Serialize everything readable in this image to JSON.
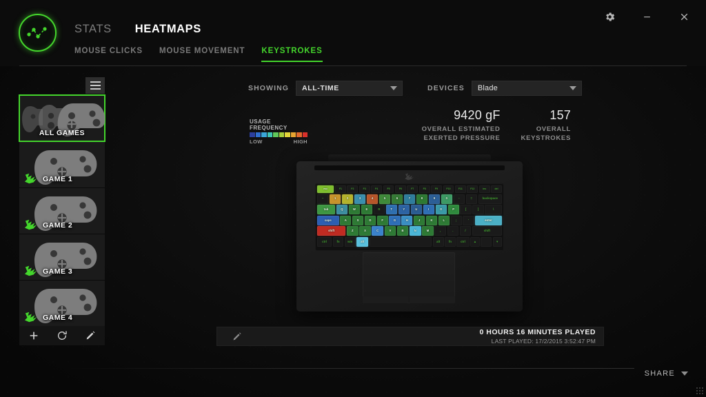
{
  "window": {
    "controls": [
      {
        "name": "settings-button",
        "icon": "gear-icon"
      },
      {
        "name": "minimize-button",
        "icon": "minimize-icon"
      },
      {
        "name": "close-button",
        "icon": "close-icon"
      }
    ]
  },
  "header": {
    "logo_icon": "razer-stats-logo-icon",
    "tabs": [
      {
        "label": "STATS",
        "active": false
      },
      {
        "label": "HEATMAPS",
        "active": true
      }
    ],
    "subtabs": [
      {
        "label": "MOUSE CLICKS",
        "active": false
      },
      {
        "label": "MOUSE MOVEMENT",
        "active": false
      },
      {
        "label": "KEYSTROKES",
        "active": true
      }
    ]
  },
  "sidebar": {
    "menu_icon": "hamburger-icon",
    "items": [
      {
        "label": "ALL GAMES",
        "selected": true,
        "has_icon": false
      },
      {
        "label": "GAME 1",
        "selected": false,
        "has_icon": true
      },
      {
        "label": "GAME 2",
        "selected": false,
        "has_icon": true
      },
      {
        "label": "GAME 3",
        "selected": false,
        "has_icon": true
      },
      {
        "label": "GAME 4",
        "selected": false,
        "has_icon": true
      }
    ],
    "actions": [
      {
        "name": "add-game-button",
        "icon": "plus-icon"
      },
      {
        "name": "refresh-games-button",
        "icon": "refresh-icon"
      },
      {
        "name": "edit-game-button",
        "icon": "pencil-icon"
      }
    ]
  },
  "toolbar": {
    "showing_label": "SHOWING",
    "showing_value": "ALL-TIME",
    "devices_label": "DEVICES",
    "devices_value": "Blade"
  },
  "legend": {
    "title": "USAGE FREQUENCY",
    "low_label": "LOW",
    "high_label": "HIGH",
    "colors": [
      "#2b3f9e",
      "#2f6fd0",
      "#3aa7d9",
      "#3fc4b4",
      "#5fc85a",
      "#a8cf3c",
      "#e3d43a",
      "#e8a531",
      "#e0692c",
      "#d8302a"
    ]
  },
  "stats": [
    {
      "value": "9420 gF",
      "label": "OVERALL ESTIMATED\nEXERTED PRESSURE"
    },
    {
      "value": "157",
      "label": "OVERALL\nKEYSTROKES"
    }
  ],
  "playbar": {
    "edit_icon": "pencil-icon",
    "time_played": "0 HOURS 16 MINUTES PLAYED",
    "last_played": "LAST PLAYED: 17/2/2015 3:52:47 PM"
  },
  "footer": {
    "share_label": "SHARE",
    "share_caret_icon": "chevron-down-icon"
  },
  "keyboard": {
    "device": "Blade",
    "rows": [
      [
        {
          "label": "esc",
          "color": "#7fbf2e",
          "w": 1.55,
          "lit": true
        },
        {
          "label": "F1",
          "color": "",
          "w": 1
        },
        {
          "label": "F2",
          "color": "",
          "w": 1
        },
        {
          "label": "F3",
          "color": "",
          "w": 1
        },
        {
          "label": "F4",
          "color": "",
          "w": 1
        },
        {
          "label": "F5",
          "color": "",
          "w": 1
        },
        {
          "label": "F6",
          "color": "",
          "w": 1
        },
        {
          "label": "F7",
          "color": "",
          "w": 1
        },
        {
          "label": "F8",
          "color": "",
          "w": 1
        },
        {
          "label": "F9",
          "color": "",
          "w": 1
        },
        {
          "label": "F10",
          "color": "",
          "w": 1
        },
        {
          "label": "F11",
          "color": "",
          "w": 1
        },
        {
          "label": "F12",
          "color": "",
          "w": 1
        },
        {
          "label": "ins",
          "color": "",
          "w": 1
        },
        {
          "label": "del",
          "color": "",
          "w": 1
        }
      ],
      [
        {
          "label": "~",
          "color": "",
          "w": 1
        },
        {
          "label": "1",
          "color": "#c8932c",
          "w": 1,
          "lit": true
        },
        {
          "label": "2",
          "color": "#b5b32c",
          "w": 1,
          "lit": true
        },
        {
          "label": "3",
          "color": "#3a8fae",
          "w": 1,
          "lit": true
        },
        {
          "label": "4",
          "color": "#b8562a",
          "w": 1,
          "lit": true
        },
        {
          "label": "5",
          "color": "#3f8a3a",
          "w": 1,
          "lit": true
        },
        {
          "label": "6",
          "color": "#357a35",
          "w": 1,
          "lit": true
        },
        {
          "label": "7",
          "color": "#2f7d9c",
          "w": 1,
          "lit": true
        },
        {
          "label": "8",
          "color": "#2e7a33",
          "w": 1,
          "lit": true
        },
        {
          "label": "9",
          "color": "#2c5f96",
          "w": 1,
          "lit": true
        },
        {
          "label": "0",
          "color": "#3d9a64",
          "w": 1,
          "lit": true
        },
        {
          "label": "-",
          "color": "",
          "w": 1
        },
        {
          "label": "=",
          "color": "",
          "w": 1
        },
        {
          "label": "backspace",
          "color": "",
          "w": 2.1
        }
      ],
      [
        {
          "label": "tab",
          "color": "#3e9642",
          "w": 1.6,
          "lit": true
        },
        {
          "label": "Q",
          "color": "#3d8ea0",
          "w": 1,
          "lit": true
        },
        {
          "label": "W",
          "color": "#2e7a35",
          "w": 1,
          "lit": true
        },
        {
          "label": "E",
          "color": "#2e7a35",
          "w": 1,
          "lit": true
        },
        {
          "label": "R",
          "color": "",
          "w": 1
        },
        {
          "label": "T",
          "color": "#2f6fb0",
          "w": 1,
          "lit": true
        },
        {
          "label": "Y",
          "color": "#2d63a3",
          "w": 1,
          "lit": true
        },
        {
          "label": "U",
          "color": "#2b5c92",
          "w": 1,
          "lit": true
        },
        {
          "label": "I",
          "color": "#2f6fb4",
          "w": 1,
          "lit": true
        },
        {
          "label": "O",
          "color": "#3a9aa8",
          "w": 1,
          "lit": true
        },
        {
          "label": "P",
          "color": "#2f8a3d",
          "w": 1,
          "lit": true
        },
        {
          "label": "[",
          "color": "",
          "w": 1
        },
        {
          "label": "]",
          "color": "",
          "w": 1
        },
        {
          "label": "\\",
          "color": "",
          "w": 1.5
        }
      ],
      [
        {
          "label": "caps",
          "color": "#2d5fb2",
          "w": 1.95,
          "lit": true
        },
        {
          "label": "A",
          "color": "#2e7a35",
          "w": 1,
          "lit": true
        },
        {
          "label": "S",
          "color": "#2e7a35",
          "w": 1,
          "lit": true
        },
        {
          "label": "D",
          "color": "#2e7a35",
          "w": 1,
          "lit": true
        },
        {
          "label": "F",
          "color": "#2e7a35",
          "w": 1,
          "lit": true
        },
        {
          "label": "G",
          "color": "#2f6fb8",
          "w": 1,
          "lit": true
        },
        {
          "label": "H",
          "color": "#3b8fc4",
          "w": 1,
          "lit": true
        },
        {
          "label": "J",
          "color": "#2e7a35",
          "w": 1,
          "lit": true
        },
        {
          "label": "K",
          "color": "#2e7a35",
          "w": 1,
          "lit": true
        },
        {
          "label": "L",
          "color": "#2e7a35",
          "w": 1,
          "lit": true
        },
        {
          "label": ";",
          "color": "",
          "w": 1
        },
        {
          "label": "'",
          "color": "",
          "w": 1
        },
        {
          "label": "enter",
          "color": "#4bb0c6",
          "w": 2.4,
          "lit": true
        }
      ],
      [
        {
          "label": "shift",
          "color": "#c02b22",
          "w": 2.5,
          "lit": true
        },
        {
          "label": "Z",
          "color": "#2e7a35",
          "w": 1,
          "lit": true
        },
        {
          "label": "X",
          "color": "#2e7a35",
          "w": 1,
          "lit": true
        },
        {
          "label": "C",
          "color": "#3b82cc",
          "w": 1,
          "lit": true
        },
        {
          "label": "V",
          "color": "#2e7a35",
          "w": 1,
          "lit": true
        },
        {
          "label": "B",
          "color": "#2e7a35",
          "w": 1,
          "lit": true
        },
        {
          "label": "N",
          "color": "#4bb6d6",
          "w": 1,
          "lit": true
        },
        {
          "label": "M",
          "color": "#2e7a35",
          "w": 1,
          "lit": true
        },
        {
          "label": ",",
          "color": "",
          "w": 1
        },
        {
          "label": ".",
          "color": "",
          "w": 1
        },
        {
          "label": "/",
          "color": "",
          "w": 1
        },
        {
          "label": "shift",
          "color": "",
          "w": 2.6
        }
      ],
      [
        {
          "label": "ctrl",
          "color": "",
          "w": 1.5
        },
        {
          "label": "fn",
          "color": "",
          "w": 1.1
        },
        {
          "label": "win",
          "color": "",
          "w": 1.1
        },
        {
          "label": "alt",
          "color": "#59c0dd",
          "w": 1.2,
          "lit": true
        },
        {
          "label": "",
          "color": "",
          "w": 6.4
        },
        {
          "label": "alt",
          "color": "",
          "w": 1.1
        },
        {
          "label": "fn",
          "color": "",
          "w": 1.1
        },
        {
          "label": "ctrl",
          "color": "",
          "w": 1.3
        },
        {
          "label": "▲",
          "color": "",
          "w": 0.95
        },
        {
          "label": "",
          "color": "",
          "w": 1.1
        },
        {
          "label": "▼",
          "color": "",
          "w": 0.95
        }
      ]
    ]
  }
}
